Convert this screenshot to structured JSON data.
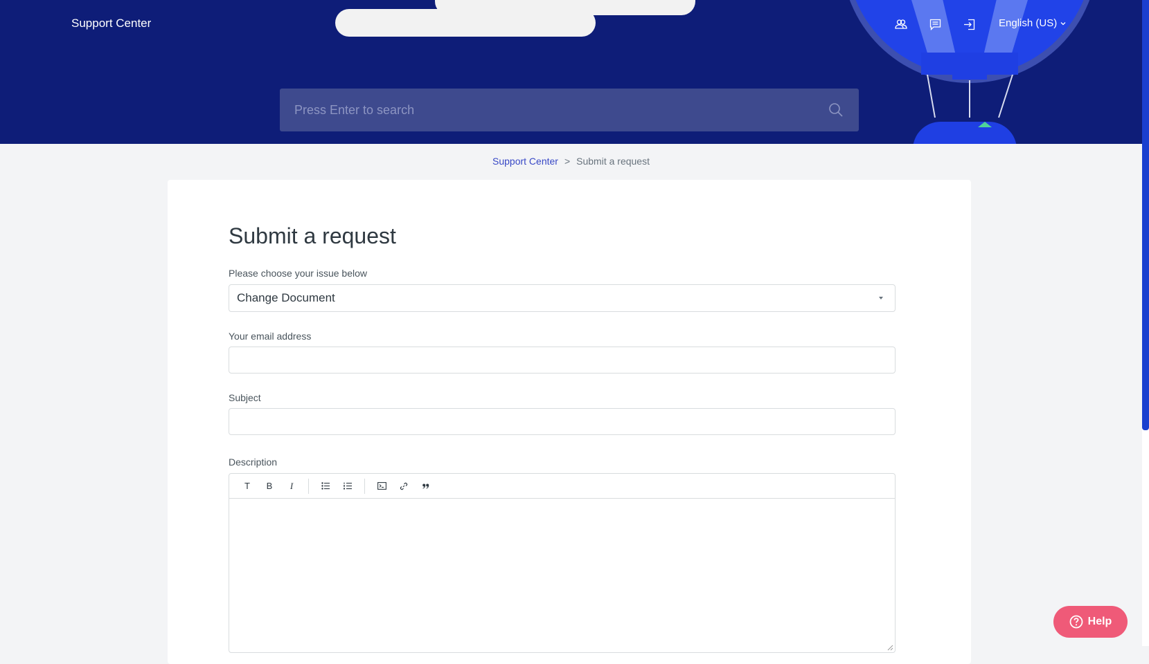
{
  "header": {
    "brand": "Support Center",
    "language": "English (US)",
    "nav_icons": [
      "community-icon",
      "requests-icon",
      "sign-in-icon"
    ],
    "background_color": "#0e1d78"
  },
  "search": {
    "placeholder": "Press Enter to search"
  },
  "breadcrumb": {
    "home": "Support Center",
    "separator": ">",
    "current": "Submit a request"
  },
  "form": {
    "title": "Submit a request",
    "issue_label": "Please choose your issue below",
    "issue_value": "Change Document",
    "email_label": "Your email address",
    "email_value": "",
    "subject_label": "Subject",
    "subject_value": "",
    "description_label": "Description",
    "toolbar": {
      "text_style": "T",
      "bold": "B",
      "italic": "I",
      "icons": [
        "bullet-list-icon",
        "numbered-list-icon",
        "code-block-icon",
        "link-icon",
        "quote-icon"
      ]
    }
  },
  "help_button": {
    "label": "Help",
    "color": "#ef5a78"
  }
}
